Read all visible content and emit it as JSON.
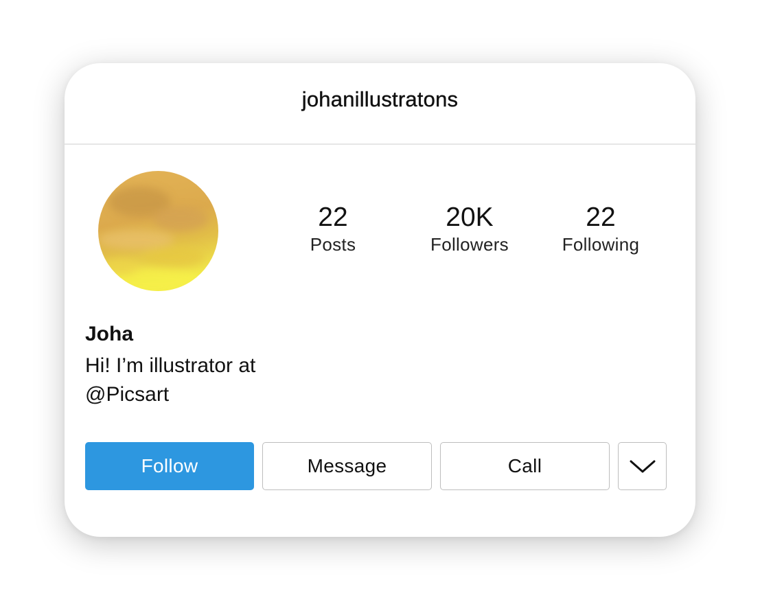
{
  "profile": {
    "username": "johanillustratons",
    "display_name": "Joha",
    "bio_lines": [
      "Hi! I’m illustrator at",
      "@Picsart"
    ],
    "avatar_colors": [
      "#e6b85a",
      "#d8a74a",
      "#f2e24a"
    ]
  },
  "stats": [
    {
      "value": "22",
      "label": "Posts"
    },
    {
      "value": "20K",
      "label": "Followers"
    },
    {
      "value": "22",
      "label": "Following"
    }
  ],
  "actions": {
    "follow_label": "Follow",
    "message_label": "Message",
    "call_label": "Call",
    "more_icon": "chevron-down-icon"
  },
  "colors": {
    "follow_button": "#2d97e0",
    "follow_text": "#ffffff",
    "border": "#bdbdbd"
  }
}
